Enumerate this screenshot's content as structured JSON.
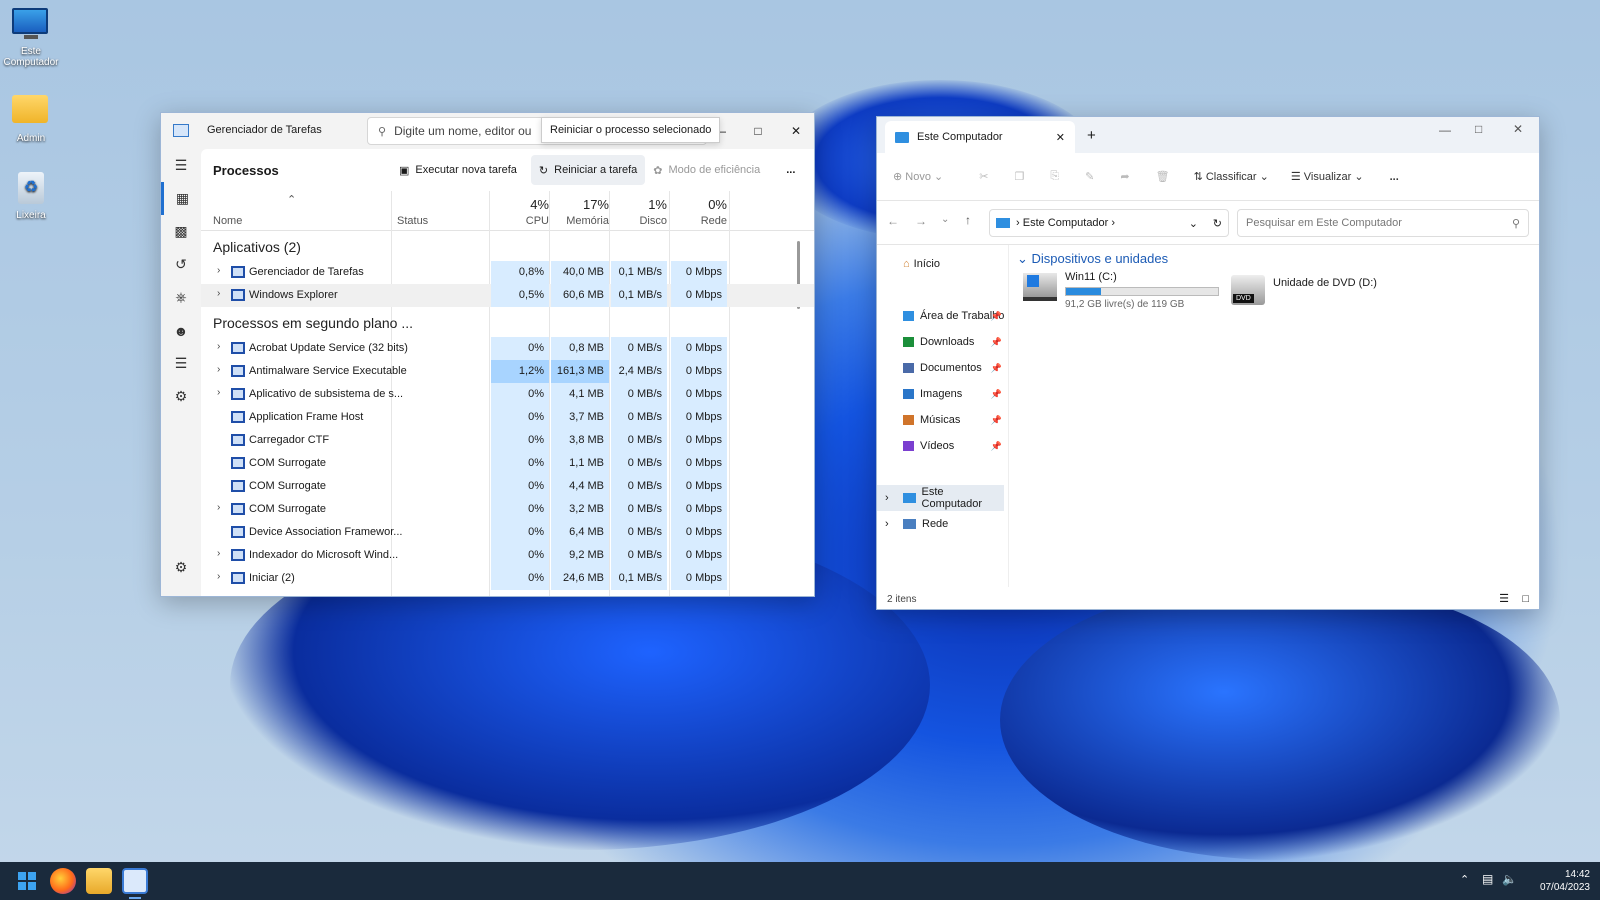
{
  "desktop": {
    "icons": [
      {
        "label": "Este Computador",
        "icon": "monitor-icon"
      },
      {
        "label": "Admin",
        "icon": "folder-icon"
      },
      {
        "label": "Lixeira",
        "icon": "recycle-bin-icon"
      }
    ]
  },
  "task_manager": {
    "title": "Gerenciador de Tarefas",
    "search_placeholder": "Digite um nome, editor ou",
    "tooltip": "Reiniciar o processo selecionado",
    "section_title": "Processos",
    "toolbar": {
      "new_task": "Executar nova tarefa",
      "restart_task": "Reiniciar a tarefa",
      "efficiency_mode": "Modo de eficiência",
      "more": "..."
    },
    "columns": {
      "name": "Nome",
      "status": "Status",
      "cpu_pct": "4%",
      "cpu": "CPU",
      "mem_pct": "17%",
      "mem": "Memória",
      "disk_pct": "1%",
      "disk": "Disco",
      "net_pct": "0%",
      "net": "Rede"
    },
    "group_apps": "Aplicativos (2)",
    "group_bg": "Processos em segundo plano ...",
    "apps": [
      {
        "name": "Gerenciador de Tarefas",
        "cpu": "0,8%",
        "mem": "40,0 MB",
        "disk": "0,1 MB/s",
        "net": "0 Mbps"
      },
      {
        "name": "Windows Explorer",
        "cpu": "0,5%",
        "mem": "60,6 MB",
        "disk": "0,1 MB/s",
        "net": "0 Mbps"
      }
    ],
    "background": [
      {
        "name": "Acrobat Update Service (32 bits)",
        "cpu": "0%",
        "mem": "0,8 MB",
        "disk": "0 MB/s",
        "net": "0 Mbps",
        "exp": true
      },
      {
        "name": "Antimalware Service Executable",
        "cpu": "1,2%",
        "mem": "161,3 MB",
        "disk": "2,4 MB/s",
        "net": "0 Mbps",
        "exp": true
      },
      {
        "name": "Aplicativo de subsistema de s...",
        "cpu": "0%",
        "mem": "4,1 MB",
        "disk": "0 MB/s",
        "net": "0 Mbps",
        "exp": true
      },
      {
        "name": "Application Frame Host",
        "cpu": "0%",
        "mem": "3,7 MB",
        "disk": "0 MB/s",
        "net": "0 Mbps",
        "exp": false
      },
      {
        "name": "Carregador CTF",
        "cpu": "0%",
        "mem": "3,8 MB",
        "disk": "0 MB/s",
        "net": "0 Mbps",
        "exp": false
      },
      {
        "name": "COM Surrogate",
        "cpu": "0%",
        "mem": "1,1 MB",
        "disk": "0 MB/s",
        "net": "0 Mbps",
        "exp": false
      },
      {
        "name": "COM Surrogate",
        "cpu": "0%",
        "mem": "4,4 MB",
        "disk": "0 MB/s",
        "net": "0 Mbps",
        "exp": false
      },
      {
        "name": "COM Surrogate",
        "cpu": "0%",
        "mem": "3,2 MB",
        "disk": "0 MB/s",
        "net": "0 Mbps",
        "exp": true
      },
      {
        "name": "Device Association Framewor...",
        "cpu": "0%",
        "mem": "6,4 MB",
        "disk": "0 MB/s",
        "net": "0 Mbps",
        "exp": false
      },
      {
        "name": "Indexador do Microsoft Wind...",
        "cpu": "0%",
        "mem": "9,2 MB",
        "disk": "0 MB/s",
        "net": "0 Mbps",
        "exp": true
      },
      {
        "name": "Iniciar (2)",
        "cpu": "0%",
        "mem": "24,6 MB",
        "disk": "0,1 MB/s",
        "net": "0 Mbps",
        "exp": true
      }
    ]
  },
  "explorer": {
    "tab_title": "Este Computador",
    "toolbar": {
      "new": "Novo",
      "sort": "Classificar",
      "view": "Visualizar",
      "more": "..."
    },
    "breadcrumb": "Este Computador",
    "search_placeholder": "Pesquisar em Este Computador",
    "nav": {
      "home": "Início",
      "quick": [
        "Área de Trabalho",
        "Downloads",
        "Documentos",
        "Imagens",
        "Músicas",
        "Vídeos"
      ],
      "this_pc": "Este Computador",
      "network": "Rede"
    },
    "section": "Dispositivos e unidades",
    "drives": [
      {
        "name": "Win11 (C:)",
        "detail": "91,2 GB livre(s) de 119 GB",
        "used_fraction": 0.23
      },
      {
        "name": "Unidade de DVD (D:)",
        "badge": "DVD"
      }
    ],
    "status": "2 itens"
  },
  "taskbar": {
    "time": "14:42",
    "date": "07/04/2023"
  }
}
